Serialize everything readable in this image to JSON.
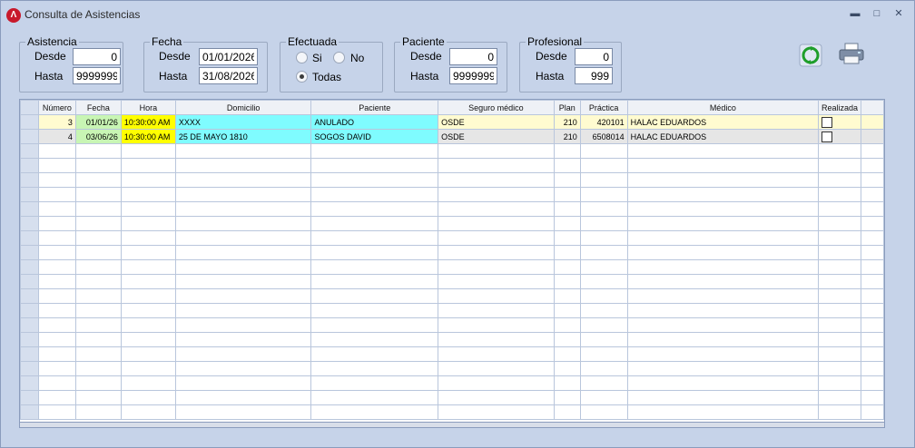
{
  "window": {
    "title": "Consulta de Asistencias"
  },
  "filters": {
    "asistencia": {
      "legend": "Asistencia",
      "desde_label": "Desde",
      "desde": "0",
      "hasta_label": "Hasta",
      "hasta": "9999999"
    },
    "fecha": {
      "legend": "Fecha",
      "desde_label": "Desde",
      "desde": "01/01/2026",
      "hasta_label": "Hasta",
      "hasta": "31/08/2026"
    },
    "efectuada": {
      "legend": "Efectuada",
      "si_label": "Si",
      "no_label": "No",
      "todas_label": "Todas",
      "selected": "Todas"
    },
    "paciente": {
      "legend": "Paciente",
      "desde_label": "Desde",
      "desde": "0",
      "hasta_label": "Hasta",
      "hasta": "9999999"
    },
    "profesional": {
      "legend": "Profesional",
      "desde_label": "Desde",
      "desde": "0",
      "hasta_label": "Hasta",
      "hasta": "999"
    }
  },
  "toolbar": {
    "refresh_icon": "refresh-icon",
    "print_icon": "printer-icon"
  },
  "table": {
    "columns": [
      "Número",
      "Fecha",
      "Hora",
      "Domicilio",
      "Paciente",
      "Seguro médico",
      "Plan",
      "Práctica",
      "Médico",
      "Realizada"
    ],
    "rows": [
      {
        "numero": "3",
        "fecha": "01/01/26",
        "hora": "10:30:00 AM",
        "domicilio": "XXXX",
        "paciente": "ANULADO",
        "seguro": "OSDE",
        "plan": "210",
        "practica": "420101",
        "medico": "HALAC EDUARDOS",
        "realizada": false,
        "row_color": "#fffbd0"
      },
      {
        "numero": "4",
        "fecha": "03/06/26",
        "hora": "10:30:00 AM",
        "domicilio": "25 DE MAYO 1810",
        "paciente": "SOGOS DAVID",
        "seguro": "OSDE",
        "plan": "210",
        "practica": "6508014",
        "medico": "HALAC EDUARDOS",
        "realizada": false,
        "row_color": "#e6e6e6"
      }
    ],
    "colors": {
      "fecha_cell": "#c8f5b4",
      "hora_cell": "#ffff00",
      "cyan_cell": "#7ffcff"
    }
  }
}
